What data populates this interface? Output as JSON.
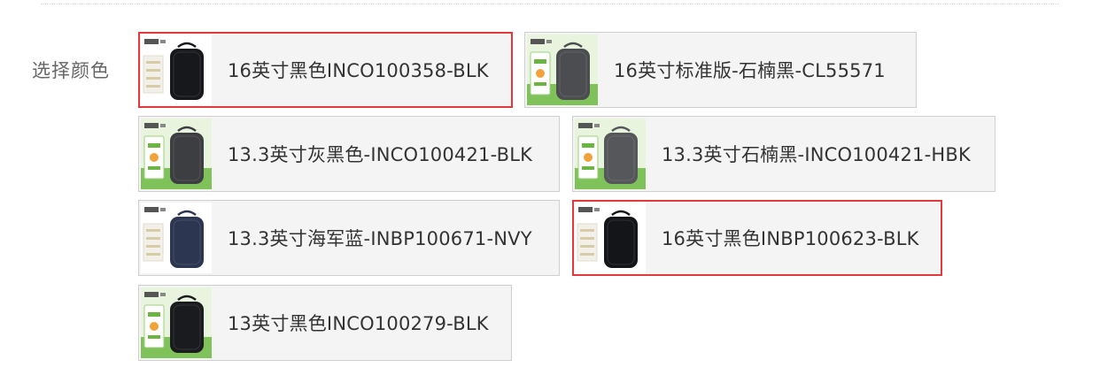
{
  "section_label": "选择颜色",
  "options": [
    {
      "label": "16英寸黑色INCO100358-BLK",
      "selected": true,
      "bag_color": "#17181c",
      "thumb_style": "white"
    },
    {
      "label": "16英寸标准版-石楠黑-CL55571",
      "selected": false,
      "bag_color": "#4b4d50",
      "thumb_style": "green"
    },
    {
      "label": "13.3英寸灰黑色-INCO100421-BLK",
      "selected": false,
      "bag_color": "#3c3e42",
      "thumb_style": "green"
    },
    {
      "label": "13.3英寸石楠黑-INCO100421-HBK",
      "selected": false,
      "bag_color": "#55575b",
      "thumb_style": "green"
    },
    {
      "label": "13.3英寸海军蓝-INBP100671-NVY",
      "selected": false,
      "bag_color": "#2c3650",
      "thumb_style": "white"
    },
    {
      "label": "16英寸黑色INBP100623-BLK",
      "selected": true,
      "bag_color": "#141518",
      "thumb_style": "white"
    },
    {
      "label": "13英寸黑色INCO100279-BLK",
      "selected": false,
      "bag_color": "#1a1b1e",
      "thumb_style": "green"
    }
  ],
  "colors": {
    "selected_border": "#e4393c",
    "default_border": "#cfcfcf",
    "option_bg": "#f4f4f4",
    "label_color": "#666666",
    "text_color": "#333333"
  }
}
